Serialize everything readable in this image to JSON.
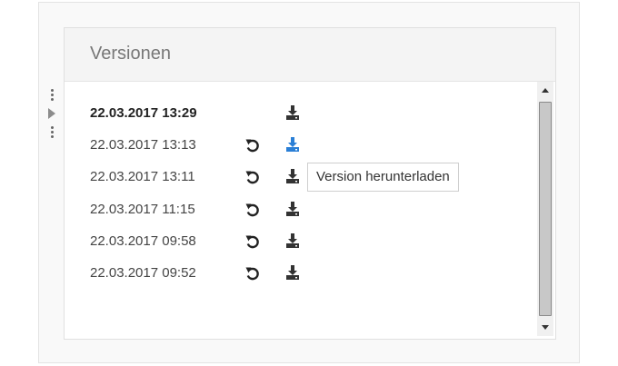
{
  "panel": {
    "title": "Versionen"
  },
  "versions": [
    {
      "date": "22.03.2017 13:29",
      "current": true,
      "restorable": false,
      "download_icon": "download-icon",
      "download_color": "#333333"
    },
    {
      "date": "22.03.2017 13:13",
      "current": false,
      "restorable": true,
      "download_icon": "download-icon",
      "download_color": "#2a7fd6"
    },
    {
      "date": "22.03.2017 13:11",
      "current": false,
      "restorable": true,
      "download_icon": "download-icon",
      "download_color": "#333333"
    },
    {
      "date": "22.03.2017 11:15",
      "current": false,
      "restorable": true,
      "download_icon": "download-icon",
      "download_color": "#333333"
    },
    {
      "date": "22.03.2017 09:58",
      "current": false,
      "restorable": true,
      "download_icon": "download-icon",
      "download_color": "#333333"
    },
    {
      "date": "22.03.2017 09:52",
      "current": false,
      "restorable": true,
      "download_icon": "download-icon",
      "download_color": "#333333"
    }
  ],
  "tooltip": {
    "text": "Version herunterladen"
  },
  "icons": {
    "restore": "restore-icon",
    "download": "download-icon",
    "side_handle": "drag-handle-icon",
    "expand": "expand-arrow-icon"
  },
  "colors": {
    "accent": "#2a7fd6",
    "icon_default": "#333333"
  }
}
